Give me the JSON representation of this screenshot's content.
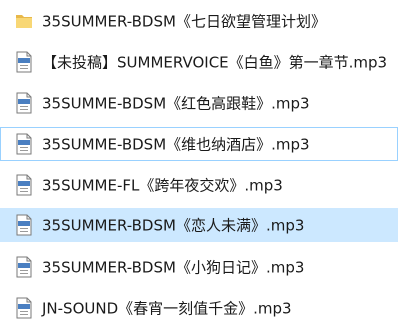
{
  "files": [
    {
      "name": "35SUMMER-BDSM《七日欲望管理计划》",
      "type": "folder",
      "icon": "folder-icon"
    },
    {
      "name": "【未投稿】SUMMERVOICE《白鱼》第一章节.mp3",
      "type": "mp3",
      "icon": "mp3-file-icon"
    },
    {
      "name": "35SUMME-BDSM《红色高跟鞋》.mp3",
      "type": "mp3",
      "icon": "mp3-file-icon"
    },
    {
      "name": "35SUMME-BDSM《维也纳酒店》.mp3",
      "type": "mp3",
      "icon": "mp3-file-icon"
    },
    {
      "name": "35SUMME-FL《跨年夜交欢》.mp3",
      "type": "mp3",
      "icon": "mp3-file-icon"
    },
    {
      "name": "35SUMMER-BDSM《恋人未满》.mp3",
      "type": "mp3",
      "icon": "mp3-file-icon"
    },
    {
      "name": "35SUMMER-BDSM《小狗日记》.mp3",
      "type": "mp3",
      "icon": "mp3-file-icon"
    },
    {
      "name": "JN-SOUND《春宵一刻值千金》.mp3",
      "type": "mp3",
      "icon": "mp3-file-icon"
    }
  ],
  "colors": {
    "folder": "#f8d775",
    "folder_dark": "#e8b84a",
    "selected_bg": "#cce8ff",
    "hover_bg": "#e5f3ff",
    "focus_border": "#99d1ff"
  }
}
